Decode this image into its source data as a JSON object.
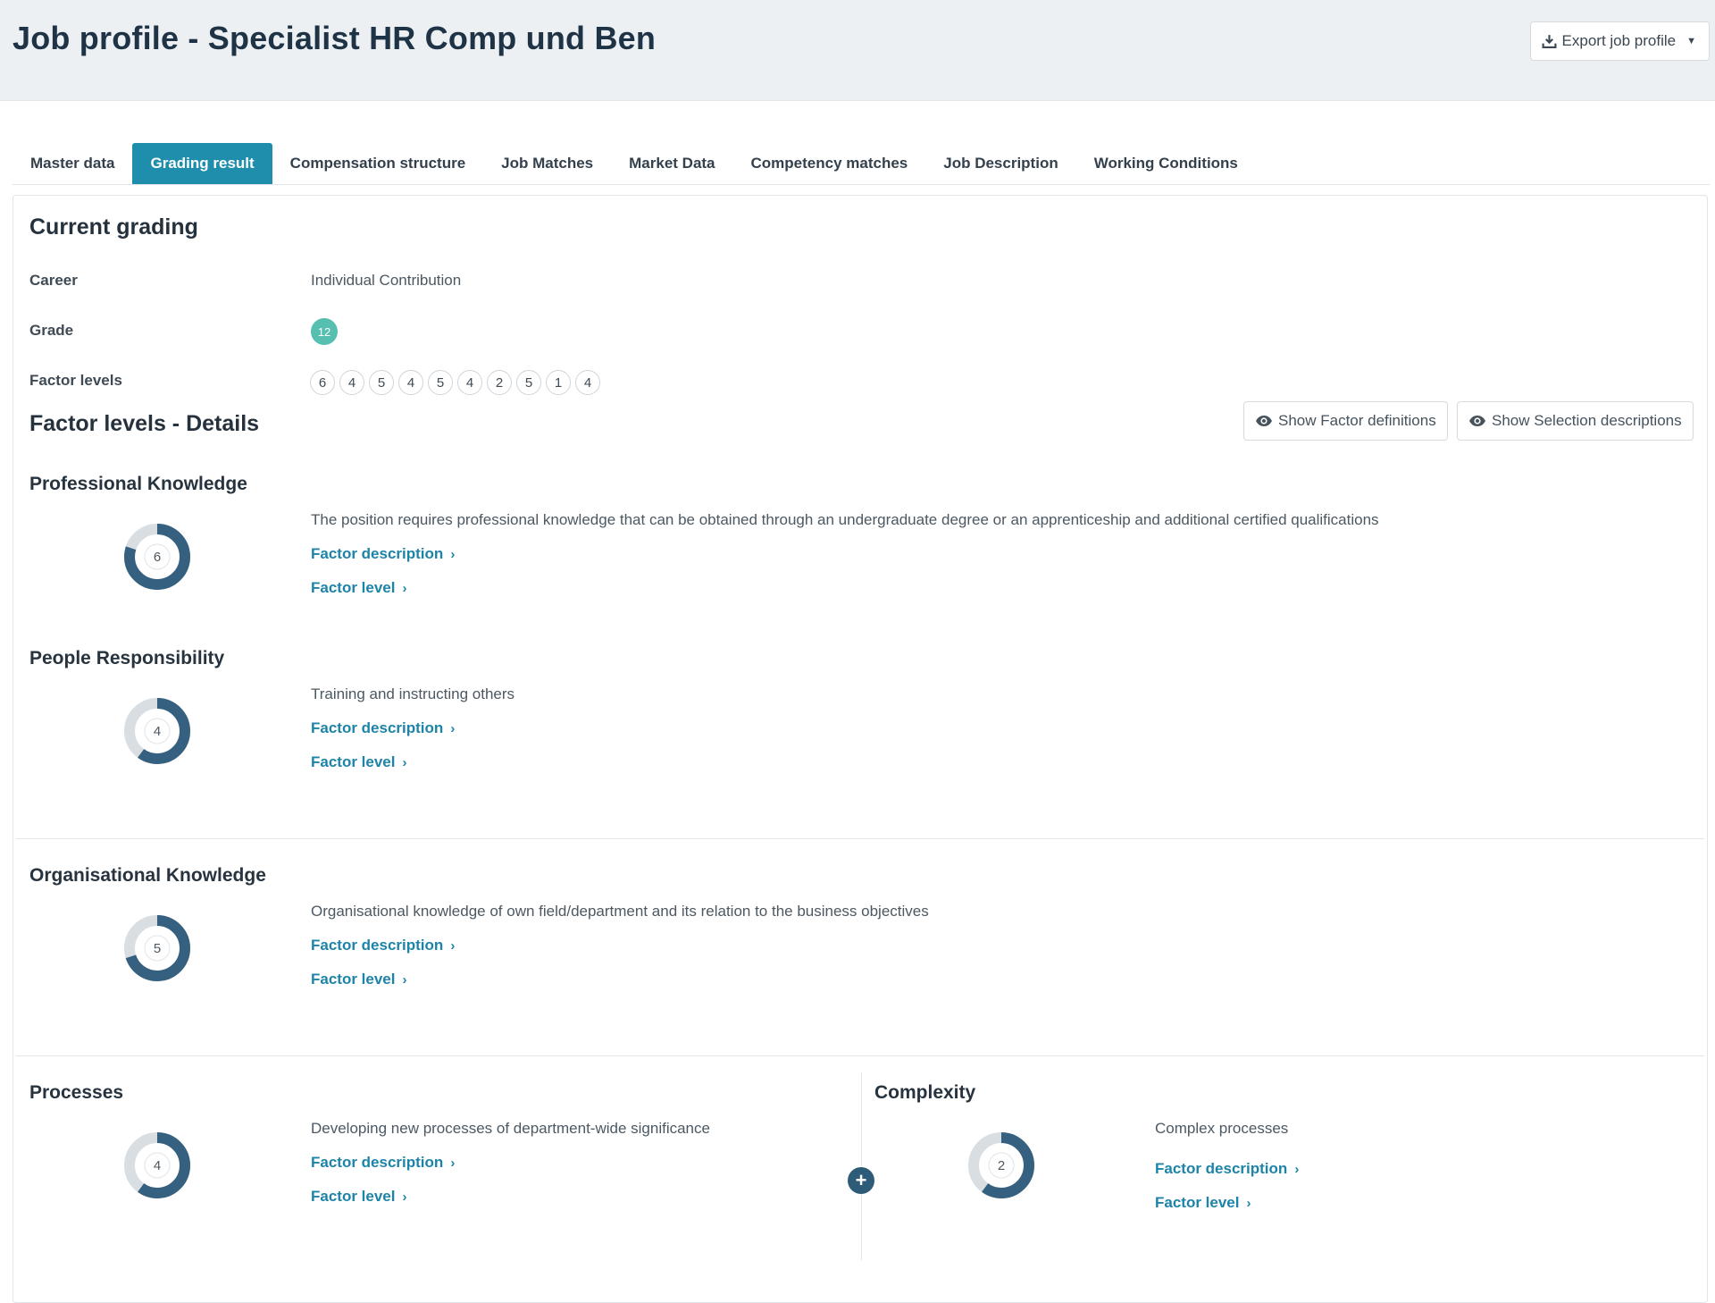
{
  "header": {
    "title": "Job profile - Specialist HR Comp und Ben",
    "export_label": "Export job profile",
    "export_icon": "download-icon"
  },
  "tabs": [
    {
      "label": "Master data",
      "active": false
    },
    {
      "label": "Grading result",
      "active": true
    },
    {
      "label": "Compensation structure",
      "active": false
    },
    {
      "label": "Job Matches",
      "active": false
    },
    {
      "label": "Market Data",
      "active": false
    },
    {
      "label": "Competency matches",
      "active": false
    },
    {
      "label": "Job Description",
      "active": false
    },
    {
      "label": "Working Conditions",
      "active": false
    }
  ],
  "current_grading": {
    "heading": "Current grading",
    "career_label": "Career",
    "career_value": "Individual Contribution",
    "grade_label": "Grade",
    "grade_value": "12",
    "factor_levels_label": "Factor levels",
    "factor_levels": [
      "6",
      "4",
      "5",
      "4",
      "5",
      "4",
      "2",
      "5",
      "1",
      "4"
    ]
  },
  "details": {
    "heading": "Factor levels - Details",
    "show_factor_definitions": "Show Factor definitions",
    "show_selection_descriptions": "Show Selection descriptions",
    "link_factor_description": "Factor description",
    "link_factor_level": "Factor level",
    "factors": [
      {
        "name": "Professional Knowledge",
        "level": "6",
        "fill": 0.8,
        "description": "The position requires professional knowledge that can be obtained through an undergraduate degree or an apprenticeship and additional certified qualifications"
      },
      {
        "name": "People Responsibility",
        "level": "4",
        "fill": 0.6,
        "description": "Training and instructing others"
      },
      {
        "name": "Organisational Knowledge",
        "level": "5",
        "fill": 0.7,
        "description": "Organisational knowledge of own field/department and its relation to the business objectives"
      },
      {
        "name": "Processes",
        "level": "4",
        "fill": 0.6,
        "description": "Developing new processes of department-wide significance"
      },
      {
        "name": "Complexity",
        "level": "2",
        "fill": 0.6,
        "description": "Complex processes"
      }
    ]
  },
  "colors": {
    "accent": "#1e8eac",
    "grade_badge": "#56bfb0",
    "donut_fill": "#35607f",
    "donut_track": "#d9dee3",
    "link": "#1d84a8"
  }
}
